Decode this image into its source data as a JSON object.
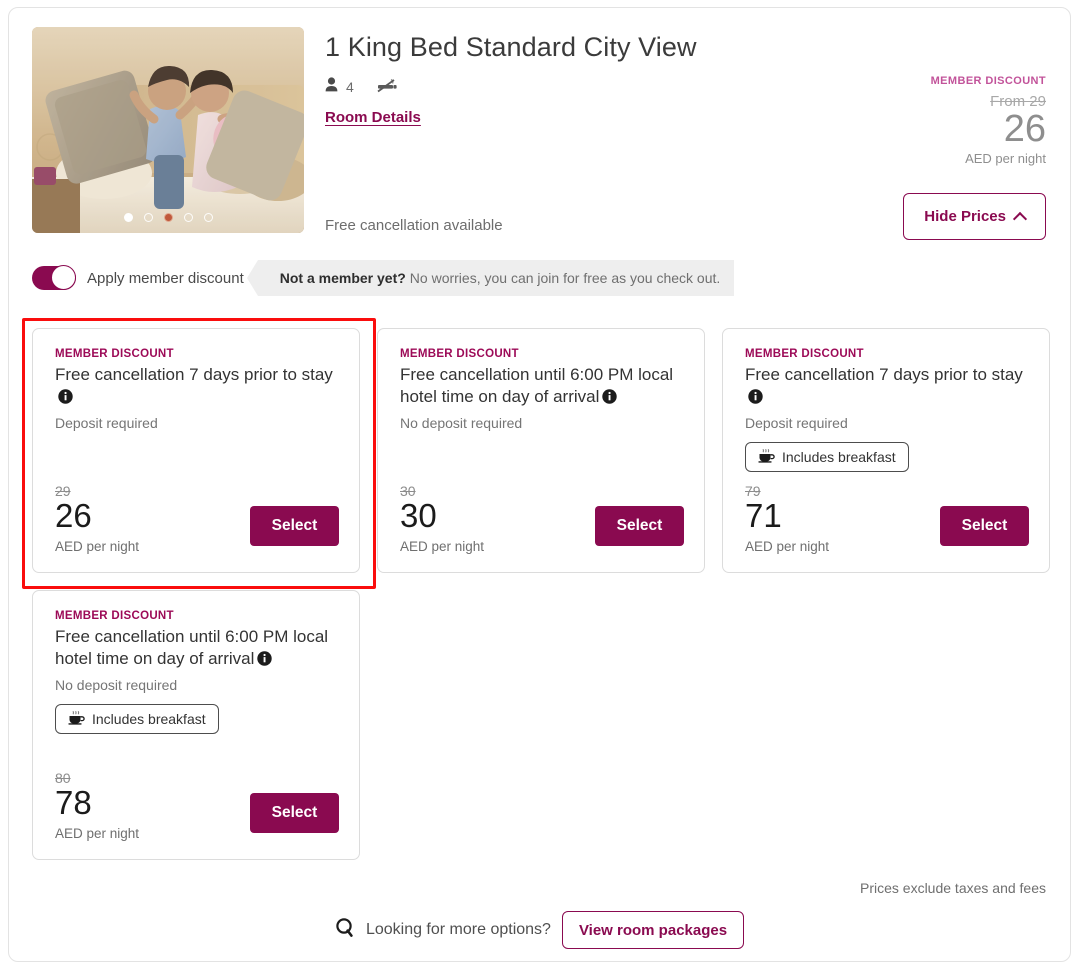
{
  "room": {
    "title": "1 King Bed Standard City View",
    "occupancy": "4",
    "occupancy_icon": "person-icon",
    "smoking_icon": "no-smoking-icon",
    "details_link": "Room Details",
    "free_cancellation_note": "Free cancellation available",
    "carousel": {
      "total_dots": 5,
      "active_index": 0
    }
  },
  "summary_price": {
    "member_tag": "MEMBER DISCOUNT",
    "from_price": "From 29",
    "price": "26",
    "currency_note": "AED per night",
    "hide_prices_label": "Hide Prices",
    "chevron_icon": "chevron-up-icon"
  },
  "member_toggle": {
    "label": "Apply member discount",
    "enabled": true,
    "banner_bold": "Not a member yet?",
    "banner_text": "No worries, you can join for free as you check out."
  },
  "rates": [
    {
      "member_tag": "MEMBER DISCOUNT",
      "headline": "Free cancellation 7 days prior to stay",
      "info_icon": "info-icon",
      "deposit": "Deposit required",
      "breakfast": null,
      "old_price": "29",
      "price": "26",
      "per_night": "AED per night",
      "select_label": "Select",
      "selected": true
    },
    {
      "member_tag": "MEMBER DISCOUNT",
      "headline": "Free cancellation until 6:00 PM local hotel time on day of arrival",
      "info_icon": "info-icon",
      "deposit": "No deposit required",
      "breakfast": null,
      "old_price": "30",
      "price": "30",
      "per_night": "AED per night",
      "select_label": "Select",
      "selected": false
    },
    {
      "member_tag": "MEMBER DISCOUNT",
      "headline": "Free cancellation 7 days prior to stay",
      "info_icon": "info-icon",
      "deposit": "Deposit required",
      "breakfast": "Includes breakfast",
      "old_price": "79",
      "price": "71",
      "per_night": "AED per night",
      "select_label": "Select",
      "selected": false
    },
    {
      "member_tag": "MEMBER DISCOUNT",
      "headline": "Free cancellation until 6:00 PM local hotel time on day of arrival",
      "info_icon": "info-icon",
      "deposit": "No deposit required",
      "breakfast": "Includes breakfast",
      "old_price": "80",
      "price": "78",
      "per_night": "AED per night",
      "select_label": "Select",
      "selected": false
    }
  ],
  "footer": {
    "prices_exclude": "Prices exclude taxes and fees",
    "search_icon": "search-icon",
    "more_options_label": "Looking for more options?",
    "view_packages_label": "View room packages"
  },
  "colors": {
    "accent": "#8a0a50",
    "member_tag": "#9c0a57",
    "selection_ring": "#fa0d0d",
    "banner_bg": "#eeeeee"
  }
}
